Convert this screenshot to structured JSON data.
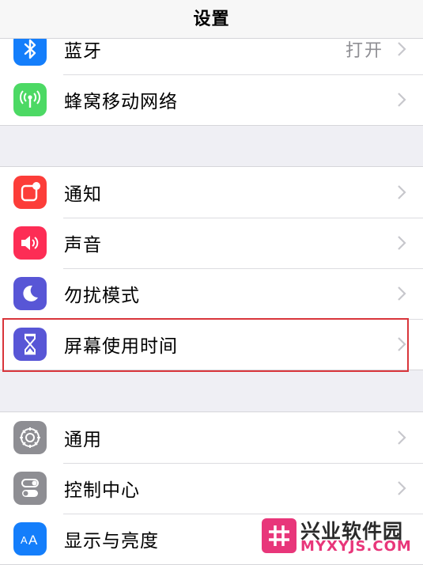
{
  "nav": {
    "title": "设置"
  },
  "group1": {
    "items": [
      {
        "label": "蓝牙",
        "value": "打开",
        "icon": "bluetooth-icon",
        "color": "#147efb"
      },
      {
        "label": "蜂窝移动网络",
        "icon": "cellular-antenna-icon",
        "color": "#4cd964"
      }
    ]
  },
  "group2": {
    "items": [
      {
        "label": "通知",
        "icon": "notifications-icon",
        "color": "#fc3d39"
      },
      {
        "label": "声音",
        "icon": "speaker-icon",
        "color": "#fd2d55"
      },
      {
        "label": "勿扰模式",
        "icon": "moon-icon",
        "color": "#5856d6"
      },
      {
        "label": "屏幕使用时间",
        "icon": "hourglass-icon",
        "color": "#5856d6"
      }
    ]
  },
  "group3": {
    "items": [
      {
        "label": "通用",
        "icon": "gear-icon",
        "color": "#8e8e93"
      },
      {
        "label": "控制中心",
        "icon": "toggles-icon",
        "color": "#8e8e93"
      },
      {
        "label": "显示与亮度",
        "icon": "text-size-icon",
        "color": "#147efb"
      }
    ]
  },
  "watermark": {
    "name": "兴业软件园",
    "url": "MYXYJS.COM",
    "color": "#e8367a"
  },
  "highlight_color": "#d9353b"
}
